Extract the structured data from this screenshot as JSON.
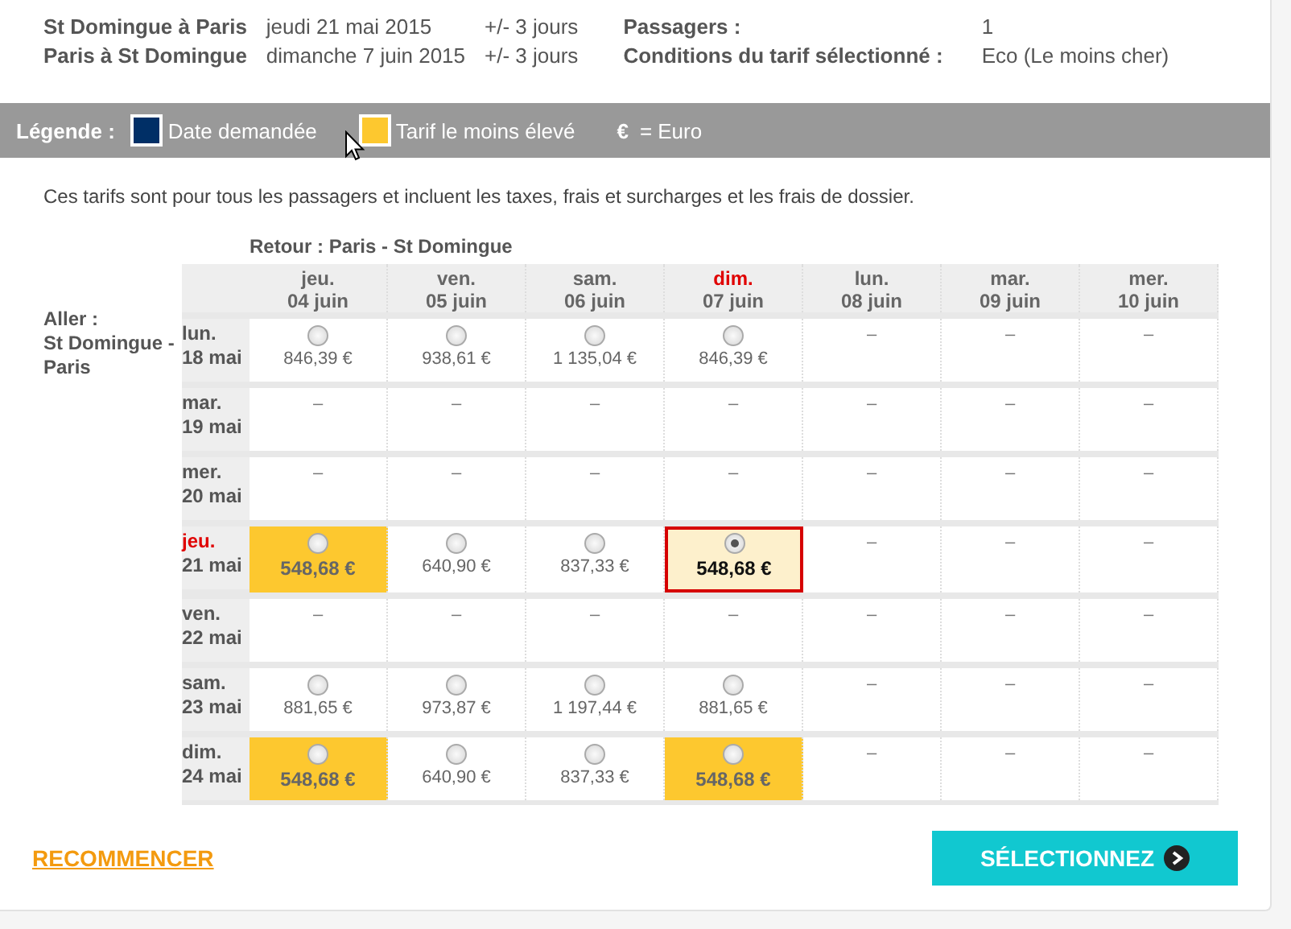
{
  "summary": {
    "left": [
      {
        "label": "St Domingue à Paris",
        "date": "jeudi 21 mai 2015",
        "flex": "+/- 3 jours"
      },
      {
        "label": "Paris à St Domingue",
        "date": "dimanche 7 juin 2015",
        "flex": "+/- 3 jours"
      }
    ],
    "right": [
      {
        "label": "Passagers :",
        "value": "1"
      },
      {
        "label": "Conditions du tarif sélectionné :",
        "value": "Eco (Le moins cher)"
      }
    ]
  },
  "legend": {
    "title": "Légende :",
    "items": [
      {
        "kind": "swatch",
        "color": "#002f66",
        "label": "Date demandée"
      },
      {
        "kind": "swatch",
        "color": "#fdc82f",
        "label": "Tarif le moins élevé"
      },
      {
        "kind": "symbol",
        "symbol": "€",
        "label": "= Euro"
      }
    ]
  },
  "note": "Ces tarifs sont pour tous les passagers et incluent les taxes, frais et surcharges et les frais de dossier.",
  "table": {
    "return_title": "Retour : Paris - St Domingue",
    "outbound_label": "Aller :",
    "outbound_route": "St Domingue - Paris",
    "columns": [
      {
        "day": "jeu.",
        "date": "04 juin",
        "requested": false
      },
      {
        "day": "ven.",
        "date": "05 juin",
        "requested": false
      },
      {
        "day": "sam.",
        "date": "06 juin",
        "requested": false
      },
      {
        "day": "dim.",
        "date": "07 juin",
        "requested": true
      },
      {
        "day": "lun.",
        "date": "08 juin",
        "requested": false
      },
      {
        "day": "mar.",
        "date": "09 juin",
        "requested": false
      },
      {
        "day": "mer.",
        "date": "10 juin",
        "requested": false
      }
    ],
    "rows": [
      {
        "day": "lun.",
        "date": "18 mai",
        "requested": false,
        "cells": [
          {
            "kind": "price",
            "price": "846,39 €",
            "lowest": false,
            "selected": false
          },
          {
            "kind": "price",
            "price": "938,61 €",
            "lowest": false,
            "selected": false
          },
          {
            "kind": "price",
            "price": "1 135,04 €",
            "lowest": false,
            "selected": false
          },
          {
            "kind": "price",
            "price": "846,39 €",
            "lowest": false,
            "selected": false
          },
          {
            "kind": "none",
            "text": "–"
          },
          {
            "kind": "none",
            "text": "–"
          },
          {
            "kind": "none",
            "text": "–"
          }
        ]
      },
      {
        "day": "mar.",
        "date": "19 mai",
        "requested": false,
        "cells": [
          {
            "kind": "none",
            "text": "–"
          },
          {
            "kind": "none",
            "text": "–"
          },
          {
            "kind": "none",
            "text": "–"
          },
          {
            "kind": "none",
            "text": "–"
          },
          {
            "kind": "none",
            "text": "–"
          },
          {
            "kind": "none",
            "text": "–"
          },
          {
            "kind": "none",
            "text": "–"
          }
        ]
      },
      {
        "day": "mer.",
        "date": "20 mai",
        "requested": false,
        "cells": [
          {
            "kind": "none",
            "text": "–"
          },
          {
            "kind": "none",
            "text": "–"
          },
          {
            "kind": "none",
            "text": "–"
          },
          {
            "kind": "none",
            "text": "–"
          },
          {
            "kind": "none",
            "text": "–"
          },
          {
            "kind": "none",
            "text": "–"
          },
          {
            "kind": "none",
            "text": "–"
          }
        ]
      },
      {
        "day": "jeu.",
        "date": "21 mai",
        "requested": true,
        "cells": [
          {
            "kind": "price",
            "price": "548,68 €",
            "lowest": true,
            "selected": false
          },
          {
            "kind": "price",
            "price": "640,90 €",
            "lowest": false,
            "selected": false
          },
          {
            "kind": "price",
            "price": "837,33 €",
            "lowest": false,
            "selected": false
          },
          {
            "kind": "price",
            "price": "548,68 €",
            "lowest": true,
            "selected": true
          },
          {
            "kind": "none",
            "text": "–"
          },
          {
            "kind": "none",
            "text": "–"
          },
          {
            "kind": "none",
            "text": "–"
          }
        ]
      },
      {
        "day": "ven.",
        "date": "22 mai",
        "requested": false,
        "cells": [
          {
            "kind": "none",
            "text": "–"
          },
          {
            "kind": "none",
            "text": "–"
          },
          {
            "kind": "none",
            "text": "–"
          },
          {
            "kind": "none",
            "text": "–"
          },
          {
            "kind": "none",
            "text": "–"
          },
          {
            "kind": "none",
            "text": "–"
          },
          {
            "kind": "none",
            "text": "–"
          }
        ]
      },
      {
        "day": "sam.",
        "date": "23 mai",
        "requested": false,
        "cells": [
          {
            "kind": "price",
            "price": "881,65 €",
            "lowest": false,
            "selected": false
          },
          {
            "kind": "price",
            "price": "973,87 €",
            "lowest": false,
            "selected": false
          },
          {
            "kind": "price",
            "price": "1 197,44 €",
            "lowest": false,
            "selected": false
          },
          {
            "kind": "price",
            "price": "881,65 €",
            "lowest": false,
            "selected": false
          },
          {
            "kind": "none",
            "text": "–"
          },
          {
            "kind": "none",
            "text": "–"
          },
          {
            "kind": "none",
            "text": "–"
          }
        ]
      },
      {
        "day": "dim.",
        "date": "24 mai",
        "requested": false,
        "cells": [
          {
            "kind": "price",
            "price": "548,68 €",
            "lowest": true,
            "selected": false
          },
          {
            "kind": "price",
            "price": "640,90 €",
            "lowest": false,
            "selected": false
          },
          {
            "kind": "price",
            "price": "837,33 €",
            "lowest": false,
            "selected": false
          },
          {
            "kind": "price",
            "price": "548,68 €",
            "lowest": true,
            "selected": false
          },
          {
            "kind": "none",
            "text": "–"
          },
          {
            "kind": "none",
            "text": "–"
          },
          {
            "kind": "none",
            "text": "–"
          }
        ]
      }
    ]
  },
  "actions": {
    "restart": "RECOMMENCER",
    "select": "SÉLECTIONNEZ"
  }
}
